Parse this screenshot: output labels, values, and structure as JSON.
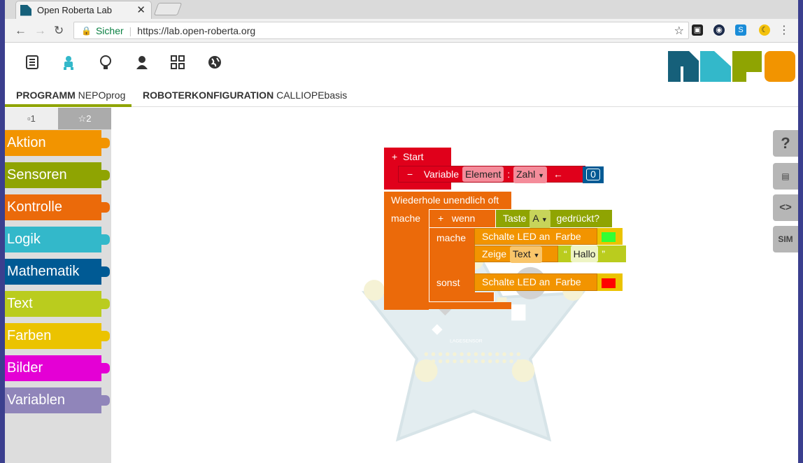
{
  "browser": {
    "tab_title": "Open Roberta Lab",
    "tab_close": "✕",
    "secure_label": "Sicher",
    "url": "https://lab.open-roberta.org"
  },
  "app": {
    "icons": [
      "program-icon",
      "robot-icon",
      "lightbulb-icon",
      "user-icon",
      "gallery-icon",
      "globe-icon"
    ],
    "tab_program_label": "PROGRAMM",
    "tab_program_name": "NEPOprog",
    "tab_config_label": "ROBOTERKONFIGURATION",
    "tab_config_name": "CALLIOPEbasis",
    "accent": "#8fa402"
  },
  "toolbox": {
    "level1": "▫1",
    "level2": "☆2",
    "categories": [
      {
        "label": "Aktion",
        "color": "#f29400"
      },
      {
        "label": "Sensoren",
        "color": "#8fa402"
      },
      {
        "label": "Kontrolle",
        "color": "#eb6a0a"
      },
      {
        "label": "Logik",
        "color": "#33b8ca"
      },
      {
        "label": "Mathematik",
        "color": "#005a94"
      },
      {
        "label": "Text",
        "color": "#bacc1e"
      },
      {
        "label": "Farben",
        "color": "#ebc300"
      },
      {
        "label": "Bilder",
        "color": "#e400d5"
      },
      {
        "label": "Variablen",
        "color": "#9085ba"
      }
    ]
  },
  "right_tools": {
    "help": "?",
    "sim": "SIM"
  },
  "blocks": {
    "start": "Start",
    "variable": "Variable",
    "var_name": "Element",
    "colon": ":",
    "var_type": "Zahl",
    "arrow": "←",
    "init_value": "0",
    "repeat": "Wiederhole unendlich oft",
    "do": "mache",
    "if": "wenn",
    "key": "Taste",
    "key_value": "A",
    "pressed": "gedrückt?",
    "do2": "mache",
    "led1": "Schalte LED an",
    "color_label": "Farbe",
    "show": "Zeige",
    "show_type": "Text",
    "text_value": "Hallo",
    "else": "sonst",
    "led2": "Schalte LED an",
    "color_label2": "Farbe",
    "led_on_color": "#33ff33",
    "led_off_color": "#ff0000"
  }
}
